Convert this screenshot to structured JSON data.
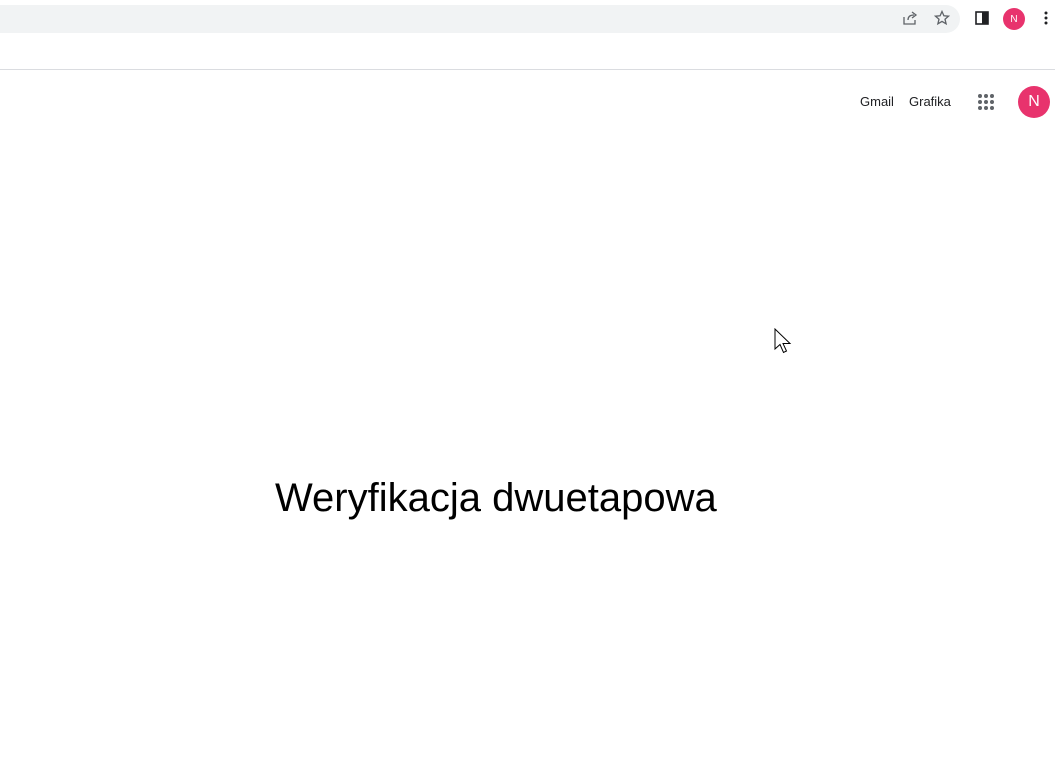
{
  "browser": {
    "profile_initial": "N",
    "icons": [
      "share-icon",
      "star-icon",
      "side-panel-icon",
      "more-vert-icon"
    ]
  },
  "header": {
    "links": [
      {
        "label": "Gmail"
      },
      {
        "label": "Grafika"
      }
    ],
    "apps_icon": "apps-grid-icon",
    "avatar_initial": "N"
  },
  "main": {
    "heading": "Weryfikacja dwuetapowa"
  },
  "colors": {
    "avatar": "#e8336d",
    "omnibox": "#f1f3f4",
    "text": "#202124"
  }
}
